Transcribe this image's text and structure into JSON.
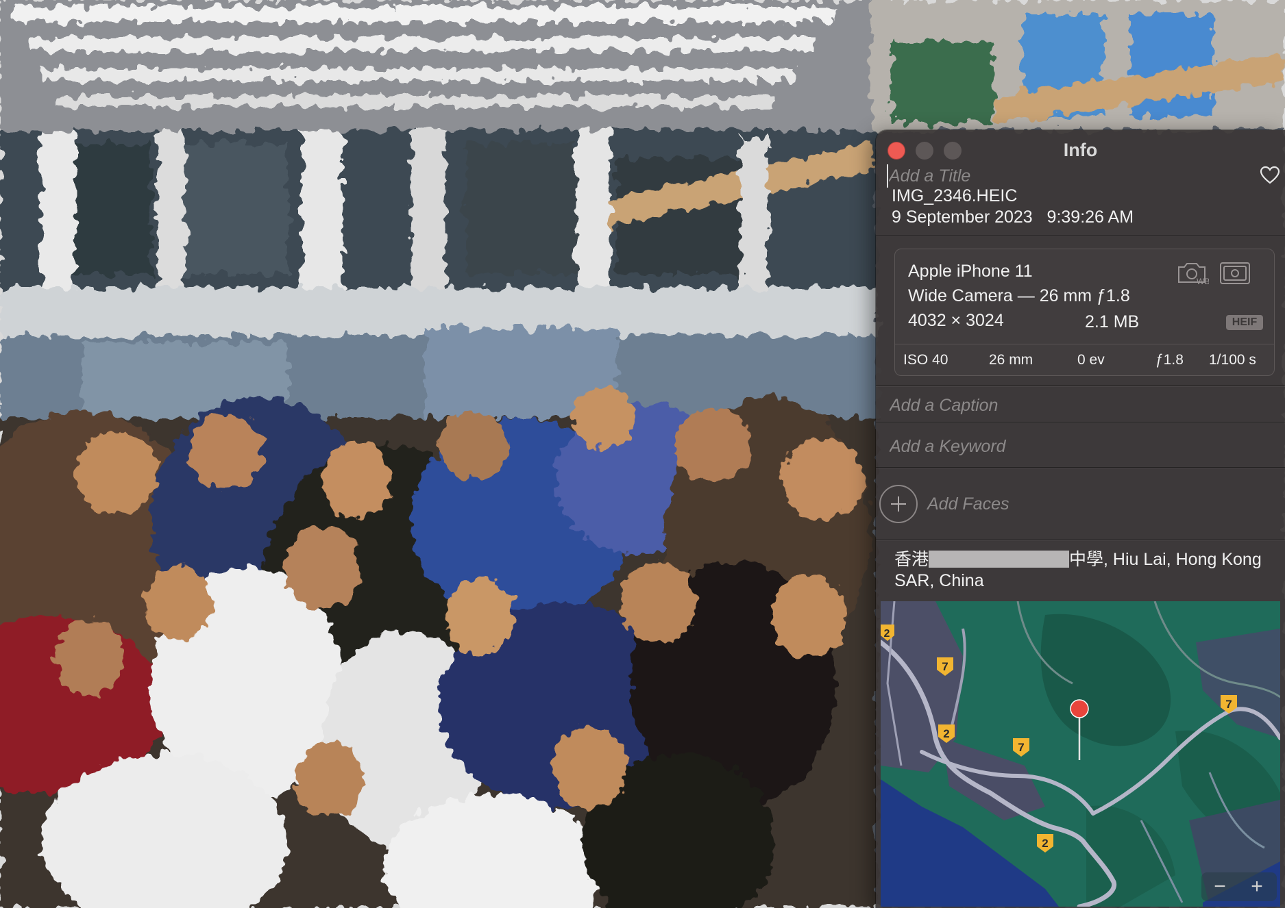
{
  "window": {
    "title": "Info",
    "title_placeholder": "Add a Title",
    "filename": "IMG_2346.HEIC",
    "date": "9 September 2023",
    "time": "9:39:26 AM",
    "favorite_icon": "heart-icon"
  },
  "camera": {
    "device": "Apple iPhone 11",
    "lens": "Wide Camera — 26 mm ƒ1.8",
    "resolution": "4032 × 3024",
    "file_size": "2.1 MB",
    "format_badge": "HEIF",
    "icons": [
      "camera-wb-icon",
      "camera-mode-icon"
    ],
    "exif": {
      "iso": "ISO 40",
      "focal_length": "26 mm",
      "exposure_bias": "0 ev",
      "aperture": "ƒ1.8",
      "shutter_speed": "1/100 s"
    }
  },
  "caption_placeholder": "Add a Caption",
  "keyword_placeholder": "Add a Keyword",
  "faces_label": "Add Faces",
  "location": {
    "prefix": "香港",
    "suffix": "中學, Hiu Lai, Hong Kong SAR, China"
  },
  "map": {
    "route_badges": [
      "2",
      "7",
      "2",
      "7",
      "2",
      "7"
    ],
    "zoom_out": "−",
    "zoom_in": "+"
  },
  "colors": {
    "close_button": "#ee5a53",
    "map_land": "#1f6b5a",
    "map_water": "#1f3a86",
    "pin": "#e8453c",
    "badge": "#f2b531"
  }
}
